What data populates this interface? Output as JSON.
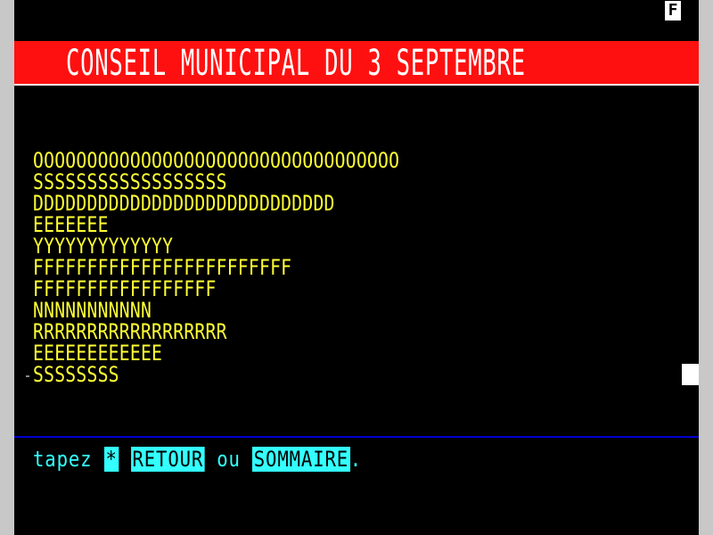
{
  "screen": {
    "mode_indicator": "F",
    "title": "CONSEIL MUNICIPAL DU 3 SEPTEMBRE",
    "rows": [
      "OOOOOOOOOOOOOOOOOOOOOOOOOOOOOOOOOO",
      "SSSSSSSSSSSSSSSSSS",
      "DDDDDDDDDDDDDDDDDDDDDDDDDDDD",
      "EEEEEEE",
      "YYYYYYYYYYYYY",
      "FFFFFFFFFFFFFFFFFFFFFFFF",
      "FFFFFFFFFFFFFFFFF",
      "NNNNNNNNNNN",
      "RRRRRRRRRRRRRRRRRR",
      "EEEEEEEEEEEE",
      "SSSSSSSS"
    ]
  },
  "footer": {
    "prefix": "tapez ",
    "star_key": "*",
    "retour_key": "RETOUR",
    "connector": " ou ",
    "sommaire_key": "SOMMAIRE",
    "suffix": "."
  },
  "colors": {
    "background": "#000000",
    "title_bar": "#ff1010",
    "body_text": "#ffff33",
    "footer_text": "#33ffff",
    "divider": "#0000d0"
  }
}
